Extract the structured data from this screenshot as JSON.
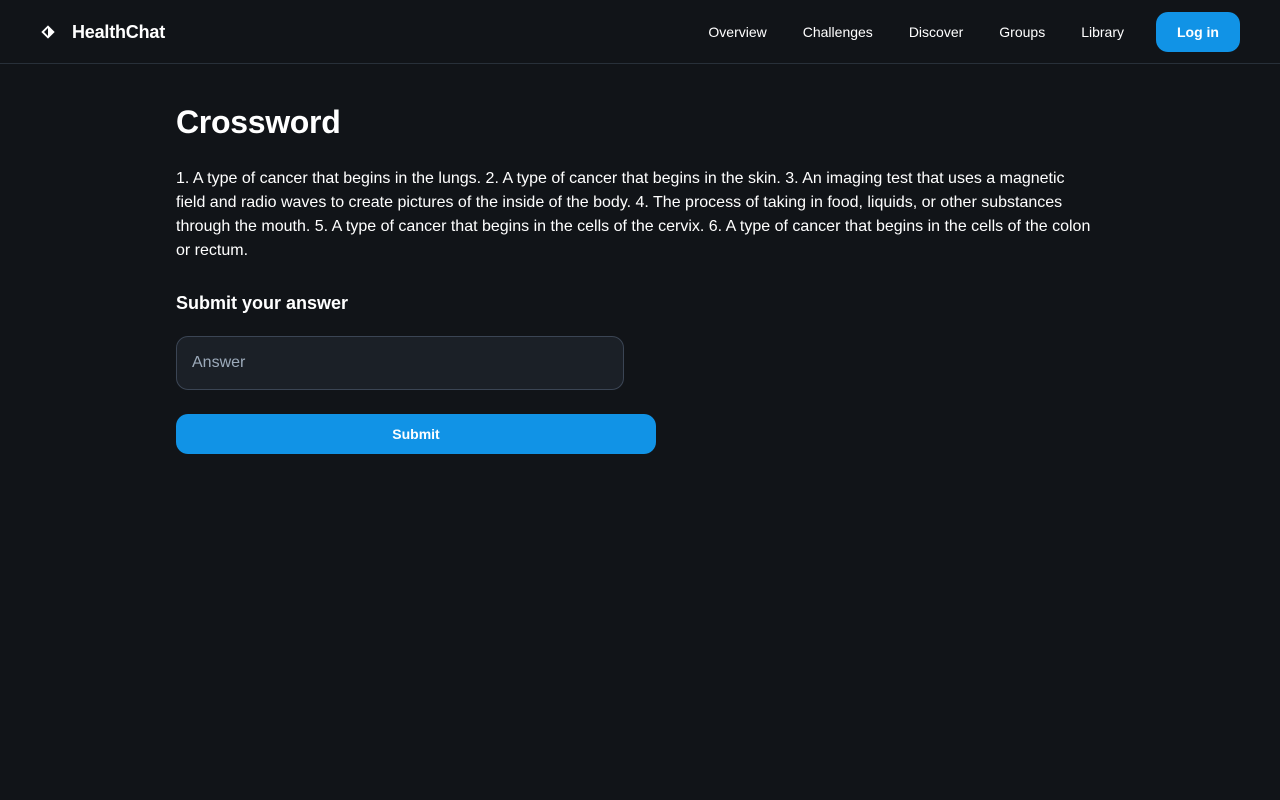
{
  "header": {
    "brand_name": "HealthChat",
    "logo_icon": "health-logo-icon",
    "nav_links": [
      {
        "label": "Overview"
      },
      {
        "label": "Challenges"
      },
      {
        "label": "Discover"
      },
      {
        "label": "Groups"
      },
      {
        "label": "Library"
      }
    ],
    "login_label": "Log in"
  },
  "main": {
    "title": "Crossword",
    "clues": "1. A type of cancer that begins in the lungs. 2. A type of cancer that begins in the skin. 3. An imaging test that uses a magnetic field and radio waves to create pictures of the inside of the body. 4. The process of taking in food, liquids, or other substances through the mouth. 5. A type of cancer that begins in the cells of the cervix. 6. A type of cancer that begins in the cells of the colon or rectum.",
    "section_title": "Submit your answer",
    "answer_input": {
      "placeholder": "Answer",
      "value": ""
    },
    "submit_label": "Submit"
  },
  "colors": {
    "background": "#111418",
    "accent": "#1193e6",
    "input_background": "#1b2027",
    "input_border": "#3b4554",
    "divider": "#283039"
  }
}
